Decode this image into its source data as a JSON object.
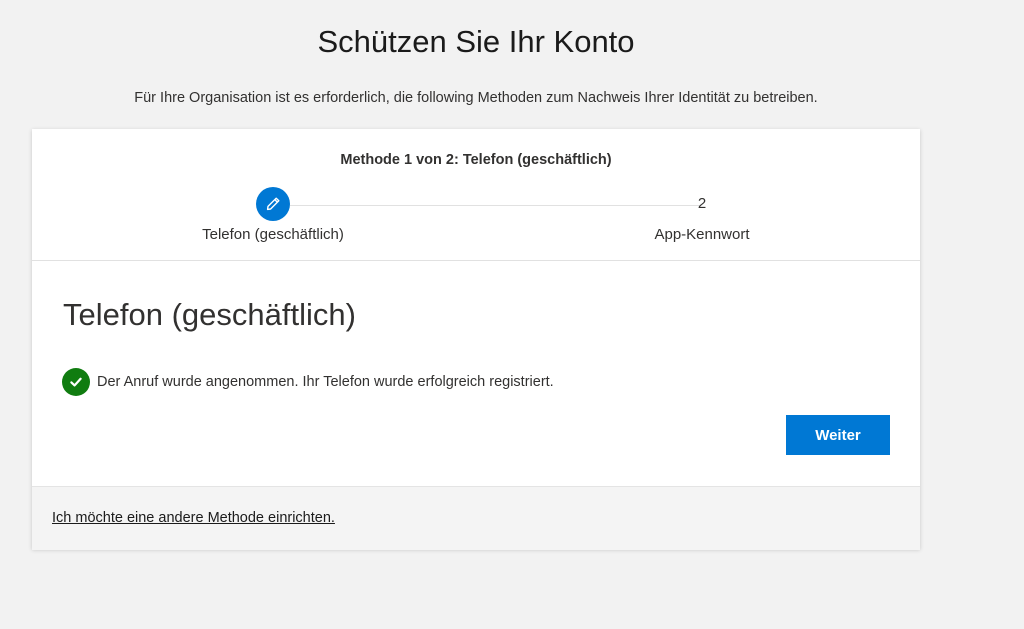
{
  "page": {
    "title": "Schützen Sie Ihr Konto",
    "subtitle": "Für Ihre Organisation ist es erforderlich, die following Methoden zum Nachweis Ihrer Identität zu betreiben."
  },
  "stepper": {
    "heading": "Methode 1 von 2: Telefon (geschäftlich)",
    "steps": [
      {
        "label": "Telefon (geschäftlich)",
        "icon": "pencil-icon",
        "state": "current"
      },
      {
        "number": "2",
        "label": "App-Kennwort",
        "state": "upcoming"
      }
    ]
  },
  "main": {
    "section_title": "Telefon (geschäftlich)",
    "status_icon": "check-circle-icon",
    "status_text": "Der Anruf wurde angenommen. Ihr Telefon wurde erfolgreich registriert.",
    "next_label": "Weiter"
  },
  "footer": {
    "other_method_link": "Ich möchte eine andere Methode einrichten."
  },
  "colors": {
    "accent": "#0078d4",
    "success": "#107c10",
    "background": "#f2f2f2"
  }
}
